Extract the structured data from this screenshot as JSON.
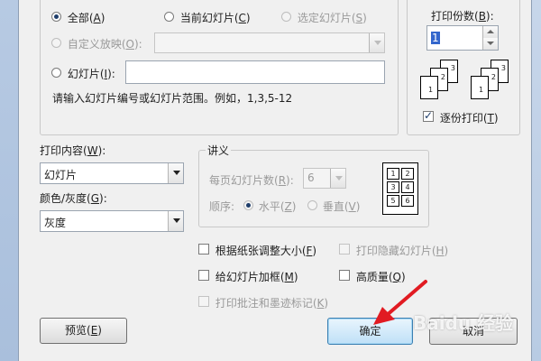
{
  "print_range": {
    "all": {
      "text": "全部(",
      "key": "A",
      "end": ")"
    },
    "current": {
      "text": "当前幻灯片(",
      "key": "C",
      "end": ")"
    },
    "selected": {
      "text": "选定幻灯片(",
      "key": "S",
      "end": ")"
    },
    "custom": {
      "text": "自定义放映(",
      "key": "O",
      "end": "):"
    },
    "slides": {
      "text": "幻灯片(",
      "key": "I",
      "end": "):"
    },
    "hint": "请输入幻灯片编号或幻灯片范围。例如，1,3,5-12"
  },
  "copies": {
    "label": {
      "text": "打印份数(",
      "key": "B",
      "end": "):"
    },
    "value": "1",
    "collate": {
      "text": "逐份打印(",
      "key": "T",
      "end": ")"
    },
    "stack_numbers": [
      "1",
      "2",
      "3"
    ]
  },
  "print_what": {
    "label": {
      "text": "打印内容(",
      "key": "W",
      "end": "):"
    },
    "value": "幻灯片"
  },
  "color": {
    "label": {
      "text": "颜色/灰度(",
      "key": "G",
      "end": "):"
    },
    "value": "灰度"
  },
  "handouts": {
    "title": "讲义",
    "per_page": {
      "text": "每页幻灯片数(",
      "key": "R",
      "end": "):"
    },
    "per_page_value": "6",
    "order": "顺序:",
    "horizontal": {
      "text": "水平(",
      "key": "Z",
      "end": ")"
    },
    "vertical": {
      "text": "垂直(",
      "key": "V",
      "end": ")"
    },
    "preview_numbers": [
      "1",
      "2",
      "3",
      "4",
      "5",
      "6"
    ]
  },
  "options": {
    "scale_to_fit": {
      "text": "根据纸张调整大小(",
      "key": "F",
      "end": ")"
    },
    "frame": {
      "text": "给幻灯片加框(",
      "key": "M",
      "end": ")"
    },
    "comments": {
      "text": "打印批注和墨迹标记(",
      "key": "K",
      "end": ")"
    },
    "hidden": {
      "text": "打印隐藏幻灯片(",
      "key": "H",
      "end": ")"
    },
    "high_quality": {
      "text": "高质量(",
      "key": "Q",
      "end": ")"
    }
  },
  "buttons": {
    "preview": {
      "text": "预览(",
      "key": "E",
      "end": ")"
    },
    "ok": "确定",
    "cancel": "取消"
  },
  "watermark": "Baidu 经验",
  "colors": {
    "arrow": "#e11b22",
    "accent": "#3c7fb1"
  }
}
